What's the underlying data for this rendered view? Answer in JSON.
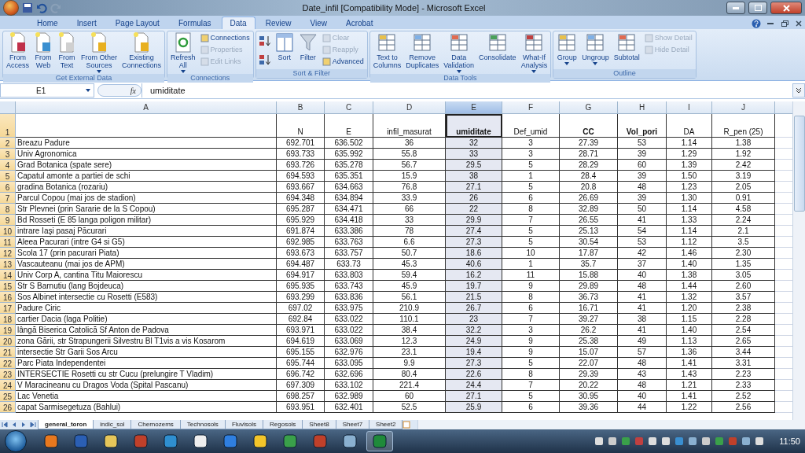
{
  "window": {
    "title": "Date_infil  [Compatibility Mode] - Microsoft Excel"
  },
  "ribbon_tabs": [
    {
      "label": "Home",
      "selected": false
    },
    {
      "label": "Insert",
      "selected": false
    },
    {
      "label": "Page Layout",
      "selected": false
    },
    {
      "label": "Formulas",
      "selected": false
    },
    {
      "label": "Data",
      "selected": true
    },
    {
      "label": "Review",
      "selected": false
    },
    {
      "label": "View",
      "selected": false
    },
    {
      "label": "Acrobat",
      "selected": false
    }
  ],
  "ribbon_groups": [
    {
      "title": "Get External Data",
      "items": [
        {
          "kind": "large",
          "label": "From\nAccess",
          "dropdown": false
        },
        {
          "kind": "large",
          "label": "From\nWeb",
          "dropdown": false
        },
        {
          "kind": "large",
          "label": "From\nText",
          "dropdown": false
        },
        {
          "kind": "large",
          "label": "From Other\nSources",
          "dropdown": true
        },
        {
          "kind": "large",
          "label": "Existing\nConnections",
          "dropdown": false
        }
      ]
    },
    {
      "title": "Connections",
      "items": [
        {
          "kind": "large",
          "label": "Refresh\nAll",
          "dropdown": true
        },
        {
          "kind": "small",
          "label": "Connections",
          "disabled": false
        },
        {
          "kind": "small",
          "label": "Properties",
          "disabled": true
        },
        {
          "kind": "small",
          "label": "Edit Links",
          "disabled": true
        }
      ]
    },
    {
      "title": "Sort & Filter",
      "items": [
        {
          "kind": "icon"
        },
        {
          "kind": "icon"
        },
        {
          "kind": "large",
          "label": "Sort",
          "dropdown": false
        },
        {
          "kind": "large",
          "label": "Filter",
          "dropdown": false
        },
        {
          "kind": "small",
          "label": "Clear",
          "disabled": true
        },
        {
          "kind": "small",
          "label": "Reapply",
          "disabled": true
        },
        {
          "kind": "small",
          "label": "Advanced",
          "disabled": false
        }
      ]
    },
    {
      "title": "Data Tools",
      "items": [
        {
          "kind": "large",
          "label": "Text to\nColumns",
          "dropdown": false
        },
        {
          "kind": "large",
          "label": "Remove\nDuplicates",
          "dropdown": false
        },
        {
          "kind": "large",
          "label": "Data\nValidation",
          "dropdown": true
        },
        {
          "kind": "large",
          "label": "Consolidate",
          "dropdown": false
        },
        {
          "kind": "large",
          "label": "What-If\nAnalysis",
          "dropdown": true
        }
      ]
    },
    {
      "title": "Outline",
      "items": [
        {
          "kind": "large",
          "label": "Group",
          "dropdown": true
        },
        {
          "kind": "large",
          "label": "Ungroup",
          "dropdown": true
        },
        {
          "kind": "large",
          "label": "Subtotal",
          "dropdown": false
        },
        {
          "kind": "small",
          "label": "Show Detail",
          "disabled": true
        },
        {
          "kind": "small",
          "label": "Hide Detail",
          "disabled": true
        }
      ]
    }
  ],
  "formula_bar": {
    "name_box": "E1",
    "function_label": "fx",
    "value": "umiditate"
  },
  "columns": [
    {
      "letter": "A",
      "selected": false
    },
    {
      "letter": "B",
      "selected": false
    },
    {
      "letter": "C",
      "selected": false
    },
    {
      "letter": "D",
      "selected": false
    },
    {
      "letter": "E",
      "selected": true
    },
    {
      "letter": "F",
      "selected": false
    },
    {
      "letter": "G",
      "selected": false
    },
    {
      "letter": "H",
      "selected": false
    },
    {
      "letter": "I",
      "selected": false
    },
    {
      "letter": "J",
      "selected": false
    }
  ],
  "header_row": {
    "number": "1",
    "cells": [
      {
        "text": "N",
        "bold": false
      },
      {
        "text": "E",
        "bold": false
      },
      {
        "text": "infil_masurat",
        "bold": false
      },
      {
        "text": "umiditate",
        "bold": true
      },
      {
        "text": "Def_umid",
        "bold": false
      },
      {
        "text": "CC",
        "bold": true
      },
      {
        "text": "Vol_pori",
        "bold": true
      },
      {
        "text": "DA",
        "bold": false
      },
      {
        "text": "R_pen (25)",
        "bold": false
      }
    ]
  },
  "rows": [
    {
      "number": "2",
      "cells": [
        "Breazu Padure",
        "692.701",
        "636.502",
        "36",
        "32",
        "3",
        "27.39",
        "53",
        "1.14",
        "1.38"
      ]
    },
    {
      "number": "3",
      "cells": [
        "Univ Agronomica",
        "693.733",
        "635.992",
        "55.8",
        "33",
        "3",
        "28.71",
        "39",
        "1.29",
        "1.92"
      ]
    },
    {
      "number": "4",
      "cells": [
        "Grad Botanica (spate sere)",
        "693.726",
        "635.278",
        "56.7",
        "29.5",
        "5",
        "28.29",
        "60",
        "1.39",
        "2.42"
      ]
    },
    {
      "number": "5",
      "cells": [
        "Capatul amonte a partiei de schi",
        "694.593",
        "635.351",
        "15.9",
        "38",
        "1",
        "28.4",
        "39",
        "1.50",
        "3.19"
      ]
    },
    {
      "number": "6",
      "cells": [
        "gradina Botanica (rozariu)",
        "693.667",
        "634.663",
        "76.8",
        "27.1",
        "5",
        "20.8",
        "48",
        "1.23",
        "2.05"
      ]
    },
    {
      "number": "7",
      "cells": [
        "Parcul Copou (mai jos de stadion)",
        "694.348",
        "634.894",
        "33.9",
        "26",
        "6",
        "26.69",
        "39",
        "1.30",
        "0.91"
      ]
    },
    {
      "number": "8",
      "cells": [
        "Str Plevnei (prin Sararie de la S Copou)",
        "695.287",
        "634.471",
        "66",
        "22",
        "8",
        "32.89",
        "50",
        "1.14",
        "4.58"
      ]
    },
    {
      "number": "9",
      "cells": [
        "Bd Rosseti (E 85 langa poligon militar)",
        "695.929",
        "634.418",
        "33",
        "29.9",
        "7",
        "26.55",
        "41",
        "1.33",
        "2.24"
      ]
    },
    {
      "number": "10",
      "cells": [
        "intrare Iaşi pasaj Pācurari",
        "691.874",
        "633.386",
        "78",
        "27.4",
        "5",
        "25.13",
        "54",
        "1.14",
        "2.1"
      ]
    },
    {
      "number": "11",
      "cells": [
        "Aleea Pacurari (intre G4 si G5)",
        "692.985",
        "633.763",
        "6.6",
        "27.3",
        "5",
        "30.54",
        "53",
        "1.12",
        "3.5"
      ]
    },
    {
      "number": "12",
      "cells": [
        "Scola 17 (prin pacurari Piata)",
        "693.673",
        "633.757",
        "50.7",
        "18.6",
        "10",
        "17.87",
        "42",
        "1.46",
        "2.30"
      ]
    },
    {
      "number": "13",
      "cells": [
        "Vascauteanu (mai jos de APM)",
        "694.487",
        "633.73",
        "45.3",
        "40.6",
        "1",
        "35.7",
        "37",
        "1.40",
        "1.35"
      ]
    },
    {
      "number": "14",
      "cells": [
        "Univ Corp A, cantina Titu Maiorescu",
        "694.917",
        "633.803",
        "59.4",
        "16.2",
        "11",
        "15.88",
        "40",
        "1.38",
        "3.05"
      ]
    },
    {
      "number": "15",
      "cells": [
        "Str S Barnutiu (lang Bojdeuca)",
        "695.935",
        "633.743",
        "45.9",
        "19.7",
        "9",
        "29.89",
        "48",
        "1.44",
        "2.60"
      ]
    },
    {
      "number": "16",
      "cells": [
        "Sos Albinet  intersectie cu Rosetti (E583)",
        "693.299",
        "633.836",
        "56.1",
        "21.5",
        "8",
        "36.73",
        "41",
        "1.32",
        "3.57"
      ]
    },
    {
      "number": "17",
      "cells": [
        "Padure Ciric",
        "697.02",
        "633.975",
        "210.9",
        "26.7",
        "6",
        "16.71",
        "41",
        "1.20",
        "2.38"
      ]
    },
    {
      "number": "18",
      "cells": [
        " cartier Dacia (laga Politie)",
        "692.84",
        "633.022",
        "110.1",
        "23",
        "7",
        "39.27",
        "38",
        "1.15",
        "2.28"
      ]
    },
    {
      "number": "19",
      "cells": [
        "lângă Biserica Catolică Sf Anton de Padova",
        "693.971",
        "633.022",
        "38.4",
        "32.2",
        "3",
        "26.2",
        "41",
        "1.40",
        "2.54"
      ]
    },
    {
      "number": "20",
      "cells": [
        "zona Gării, str Strapungerii Silvestru Bl T1vis a vis Kosarom",
        "694.619",
        "633.069",
        "12.3",
        "24.9",
        "9",
        "25.38",
        "49",
        "1.13",
        "2.65"
      ]
    },
    {
      "number": "21",
      "cells": [
        "intersectie Str Garii Sos Arcu",
        "695.155",
        "632.976",
        "23.1",
        "19.4",
        "9",
        "15.07",
        "57",
        "1.36",
        "3.44"
      ]
    },
    {
      "number": "22",
      "cells": [
        "Parc Piata Independentei",
        "695.744",
        "633.095",
        "9.9",
        "27.3",
        "5",
        "22.07",
        "48",
        "1.41",
        "3.31"
      ]
    },
    {
      "number": "23",
      "cells": [
        "INTERSECTIE Rosetti cu str Cucu (prelungire T Vladim)",
        "696.742",
        "632.696",
        "80.4",
        "22.6",
        "8",
        "29.39",
        "43",
        "1.43",
        "2.23"
      ]
    },
    {
      "number": "24",
      "cells": [
        "V Maracineanu cu Dragos Voda (Spital Pascanu)",
        "697.309",
        "633.102",
        "221.4",
        "24.4",
        "7",
        "20.22",
        "48",
        "1.21",
        "2.33"
      ]
    },
    {
      "number": "25",
      "cells": [
        "Lac Venetia",
        "698.257",
        "632.989",
        "60",
        "27.1",
        "5",
        "30.95",
        "40",
        "1.41",
        "2.52"
      ]
    },
    {
      "number": "26",
      "cells": [
        "capat Sarmisegetuza (Bahlui)",
        "693.951",
        "632.401",
        "52.5",
        "25.9",
        "6",
        "39.36",
        "44",
        "1.22",
        "2.56"
      ]
    }
  ],
  "sheet_tabs": [
    {
      "label": "general_toron",
      "selected": true
    },
    {
      "label": "indic_sol",
      "selected": false
    },
    {
      "label": "Chernozems",
      "selected": false
    },
    {
      "label": "Technosols",
      "selected": false
    },
    {
      "label": "Fluvisols",
      "selected": false
    },
    {
      "label": "Regosols",
      "selected": false
    },
    {
      "label": "Sheet8",
      "selected": false
    },
    {
      "label": "Sheet7",
      "selected": false
    },
    {
      "label": "Sheet2",
      "selected": false
    }
  ],
  "taskbar": {
    "clock": "11:50"
  }
}
